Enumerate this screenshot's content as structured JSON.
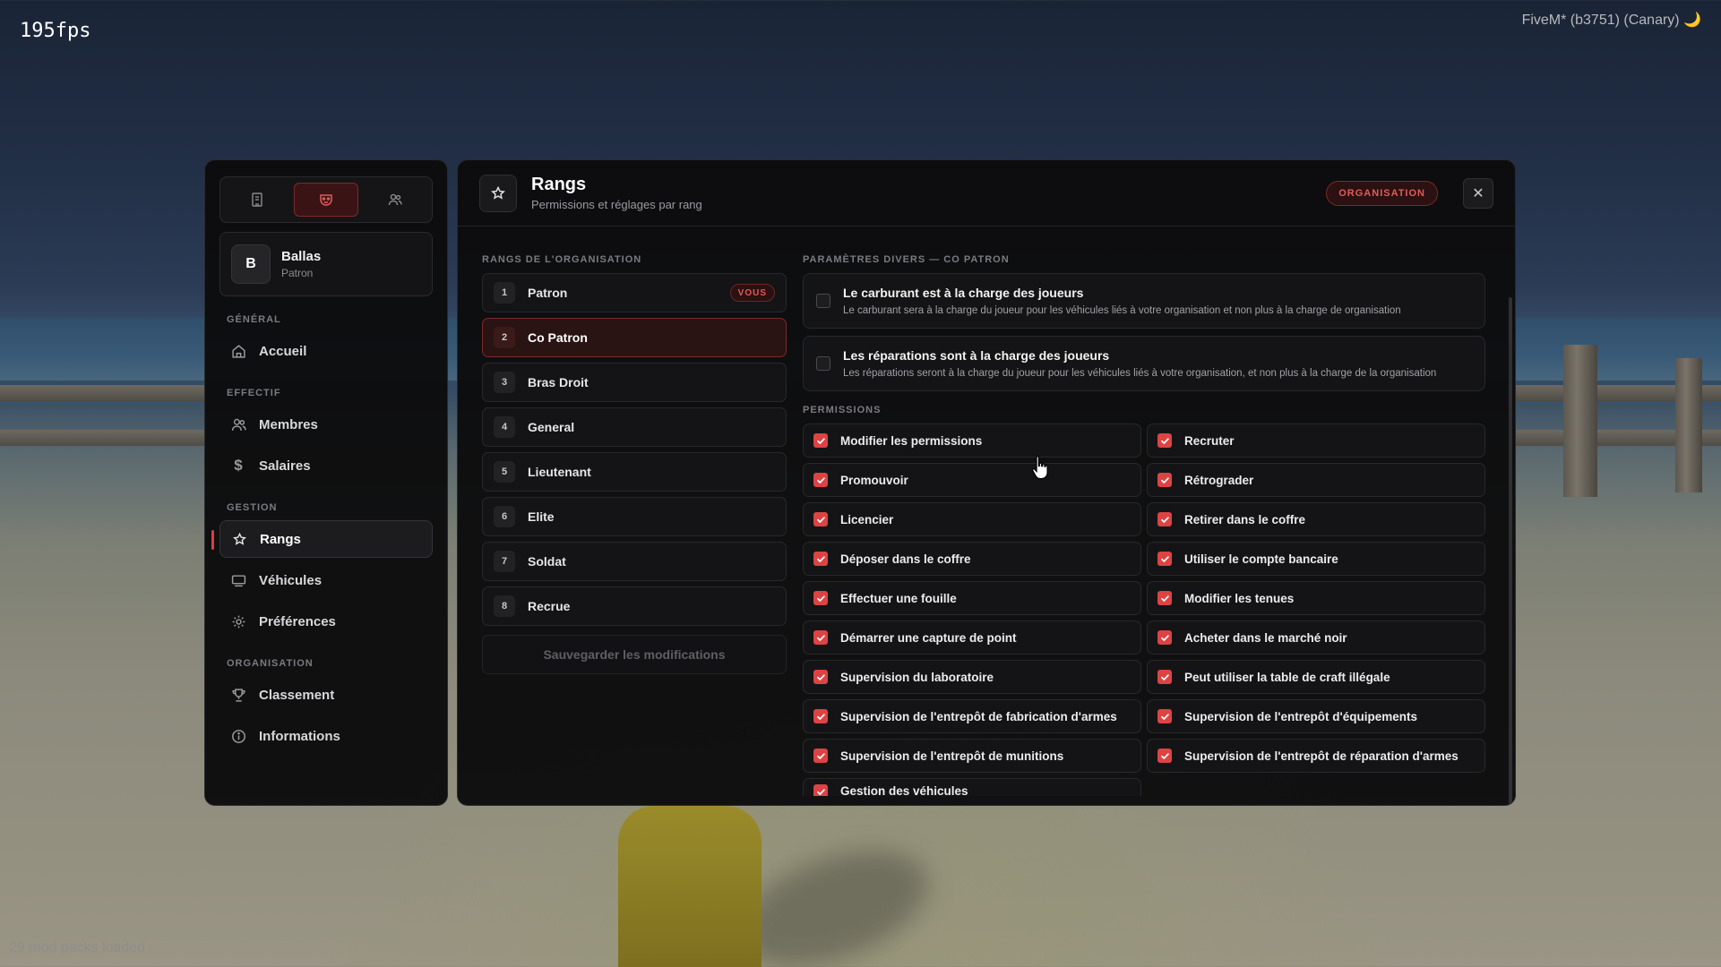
{
  "hud": {
    "fps": "195fps",
    "fivem_title": "FiveM* (b3751) (Canary) 🌙",
    "mod_packs": "29 mod packs loaded"
  },
  "sidebar": {
    "org": {
      "initial": "B",
      "name": "Ballas",
      "role": "Patron"
    },
    "sections": [
      {
        "title": "GÉNÉRAL",
        "items": [
          {
            "label": "Accueil",
            "icon": "home-icon"
          }
        ]
      },
      {
        "title": "EFFECTIF",
        "items": [
          {
            "label": "Membres",
            "icon": "users-icon"
          },
          {
            "label": "Salaires",
            "icon": "dollar-icon"
          }
        ]
      },
      {
        "title": "GESTION",
        "items": [
          {
            "label": "Rangs",
            "icon": "star-icon",
            "active": true
          },
          {
            "label": "Véhicules",
            "icon": "vehicle-icon"
          },
          {
            "label": "Préférences",
            "icon": "gear-icon"
          }
        ]
      },
      {
        "title": "ORGANISATION",
        "items": [
          {
            "label": "Classement",
            "icon": "trophy-icon"
          },
          {
            "label": "Informations",
            "icon": "info-icon"
          }
        ]
      }
    ]
  },
  "header": {
    "title": "Rangs",
    "subtitle": "Permissions et réglages par rang",
    "badge": "ORGANISATION",
    "close": "✕"
  },
  "ranks": {
    "title": "RANGS DE L'ORGANISATION",
    "items": [
      {
        "num": "1",
        "label": "Patron",
        "tag": "VOUS"
      },
      {
        "num": "2",
        "label": "Co Patron",
        "active": true
      },
      {
        "num": "3",
        "label": "Bras Droit"
      },
      {
        "num": "4",
        "label": "General"
      },
      {
        "num": "5",
        "label": "Lieutenant"
      },
      {
        "num": "6",
        "label": "Elite"
      },
      {
        "num": "7",
        "label": "Soldat"
      },
      {
        "num": "8",
        "label": "Recrue"
      }
    ],
    "save_label": "Sauvegarder les modifications"
  },
  "settings": {
    "title": "PARAMÈTRES DIVERS — CO PATRON",
    "items": [
      {
        "title": "Le carburant est à la charge des joueurs",
        "desc": "Le carburant sera à la charge du joueur pour les véhicules liés à votre organisation et non plus à la charge de organisation",
        "checked": false
      },
      {
        "title": "Les réparations sont à la charge des joueurs",
        "desc": "Les réparations seront à la charge du joueur pour les véhicules liés à votre organisation, et non plus à la charge de la organisation",
        "checked": false
      }
    ]
  },
  "permissions": {
    "title": "PERMISSIONS",
    "items": [
      {
        "label": "Modifier les permissions",
        "checked": true
      },
      {
        "label": "Recruter",
        "checked": true
      },
      {
        "label": "Promouvoir",
        "checked": true
      },
      {
        "label": "Rétrograder",
        "checked": true
      },
      {
        "label": "Licencier",
        "checked": true
      },
      {
        "label": "Retirer dans le coffre",
        "checked": true
      },
      {
        "label": "Déposer dans le coffre",
        "checked": true
      },
      {
        "label": "Utiliser le compte bancaire",
        "checked": true
      },
      {
        "label": "Effectuer une fouille",
        "checked": true
      },
      {
        "label": "Modifier les tenues",
        "checked": true
      },
      {
        "label": "Démarrer une capture de point",
        "checked": true
      },
      {
        "label": "Acheter dans le marché noir",
        "checked": true
      },
      {
        "label": "Supervision du laboratoire",
        "checked": true
      },
      {
        "label": "Peut utiliser la table de craft illégale",
        "checked": true
      },
      {
        "label": "Supervision de l'entrepôt de fabrication d'armes",
        "checked": true
      },
      {
        "label": "Supervision de l'entrepôt d'équipements",
        "checked": true
      },
      {
        "label": "Supervision de l'entrepôt de munitions",
        "checked": true
      },
      {
        "label": "Supervision de l'entrepôt de réparation d'armes",
        "checked": true
      },
      {
        "label": "Gestion des véhicules",
        "checked": true
      }
    ]
  },
  "colors": {
    "accent": "#dd4343",
    "panel": "#0c0c0d"
  }
}
